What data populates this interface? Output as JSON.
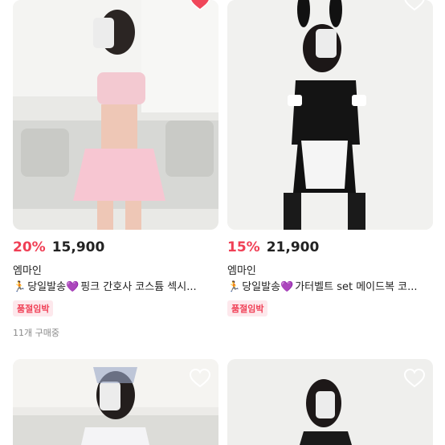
{
  "products": [
    {
      "discount": "20%",
      "price": "15,900",
      "seller": "엠마인",
      "title_emoji_1": "🏃",
      "title_text_1": "당일발송",
      "title_emoji_2": "💜",
      "title_text_2": "핑크 간호사 코스튬 섹시...",
      "badge": "품절임박",
      "sales": "11개 구매중",
      "liked": true
    },
    {
      "discount": "15%",
      "price": "21,900",
      "seller": "엠마인",
      "title_emoji_1": "🏃",
      "title_text_1": "당일발송",
      "title_emoji_2": "💜",
      "title_text_2": "가터벨트 set 메이드복 코...",
      "badge": "품절임박",
      "liked": false
    },
    {
      "liked": false
    },
    {
      "liked": false
    }
  ],
  "colors": {
    "accent": "#f03f55",
    "badge_bg": "#fde8ec",
    "heart_liked": "#f0475a",
    "heart_outline": "#ffffff"
  },
  "icons": {
    "like": "heart-icon"
  }
}
